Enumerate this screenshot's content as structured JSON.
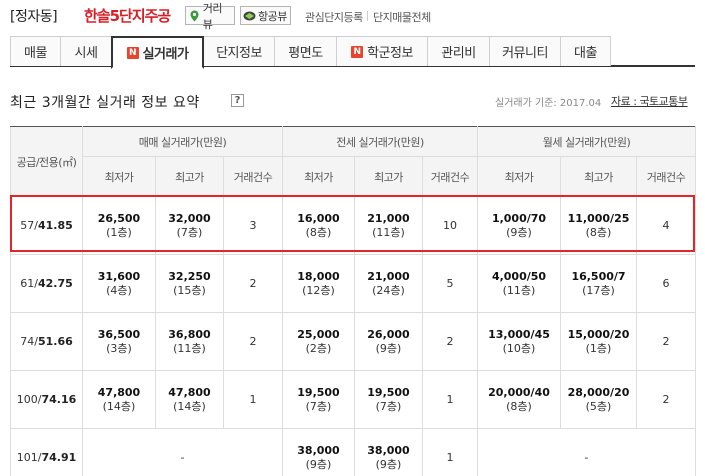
{
  "header": {
    "region": "[정자동]",
    "complex_name": "한솔5단지주공",
    "street_view_label": "거리뷰",
    "aerial_view_label": "항공뷰",
    "links": [
      "관심단지등록",
      "단지매물전체"
    ]
  },
  "tabs": [
    {
      "label": "매물",
      "badge": ""
    },
    {
      "label": "시세",
      "badge": ""
    },
    {
      "label": "실거래가",
      "badge": "N"
    },
    {
      "label": "단지정보",
      "badge": ""
    },
    {
      "label": "평면도",
      "badge": ""
    },
    {
      "label": "학군정보",
      "badge": "N"
    },
    {
      "label": "관리비",
      "badge": ""
    },
    {
      "label": "커뮤니티",
      "badge": ""
    },
    {
      "label": "대출",
      "badge": ""
    }
  ],
  "active_tab": "실거래가",
  "summary": {
    "title": "최근 3개월간 실거래 정보 요약",
    "help_label": "?",
    "basis": "실거래가 기준: 2017.04",
    "source": "자료 : 국토교통부"
  },
  "table": {
    "area_header": "공급/전용(㎡)",
    "groups": [
      "매매 실거래가(만원)",
      "전세 실거래가(만원)",
      "월세 실거래가(만원)"
    ],
    "subheaders": [
      "최저가",
      "최고가",
      "거래건수"
    ],
    "rows": [
      {
        "area_a": "57/",
        "area_b": "41.85",
        "highlight": true,
        "cells": [
          [
            "26,500",
            "(1층)"
          ],
          [
            "32,000",
            "(7층)"
          ],
          [
            "3",
            ""
          ],
          [
            "16,000",
            "(8층)"
          ],
          [
            "21,000",
            "(11층)"
          ],
          [
            "10",
            ""
          ],
          [
            "1,000/70",
            "(9층)"
          ],
          [
            "11,000/25",
            "(8층)"
          ],
          [
            "4",
            ""
          ]
        ]
      },
      {
        "area_a": "61/",
        "area_b": "42.75",
        "highlight": false,
        "cells": [
          [
            "31,600",
            "(4층)"
          ],
          [
            "32,250",
            "(15층)"
          ],
          [
            "2",
            ""
          ],
          [
            "18,000",
            "(12층)"
          ],
          [
            "21,000",
            "(24층)"
          ],
          [
            "5",
            ""
          ],
          [
            "4,000/50",
            "(11층)"
          ],
          [
            "16,500/7",
            "(17층)"
          ],
          [
            "6",
            ""
          ]
        ]
      },
      {
        "area_a": "74/",
        "area_b": "51.66",
        "highlight": false,
        "cells": [
          [
            "36,500",
            "(3층)"
          ],
          [
            "36,800",
            "(11층)"
          ],
          [
            "2",
            ""
          ],
          [
            "25,000",
            "(2층)"
          ],
          [
            "26,000",
            "(9층)"
          ],
          [
            "2",
            ""
          ],
          [
            "13,000/45",
            "(10층)"
          ],
          [
            "15,000/20",
            "(1층)"
          ],
          [
            "2",
            ""
          ]
        ]
      },
      {
        "area_a": "100/",
        "area_b": "74.16",
        "highlight": false,
        "cells": [
          [
            "47,800",
            "(14층)"
          ],
          [
            "47,800",
            "(14층)"
          ],
          [
            "1",
            ""
          ],
          [
            "19,500",
            "(7층)"
          ],
          [
            "19,500",
            "(7층)"
          ],
          [
            "1",
            ""
          ],
          [
            "20,000/40",
            "(8층)"
          ],
          [
            "28,000/20",
            "(5층)"
          ],
          [
            "2",
            ""
          ]
        ]
      },
      {
        "area_a": "101/",
        "area_b": "74.91",
        "highlight": false,
        "cells": [
          [
            "-",
            ""
          ],
          null,
          null,
          [
            "38,000",
            "(9층)"
          ],
          [
            "38,000",
            "(9층)"
          ],
          [
            "1",
            ""
          ],
          [
            "-",
            ""
          ],
          null,
          null
        ]
      }
    ]
  },
  "colors": {
    "accent_red": "#d81f26",
    "highlight_border": "#e3242b",
    "new_badge": "#e8442e"
  }
}
